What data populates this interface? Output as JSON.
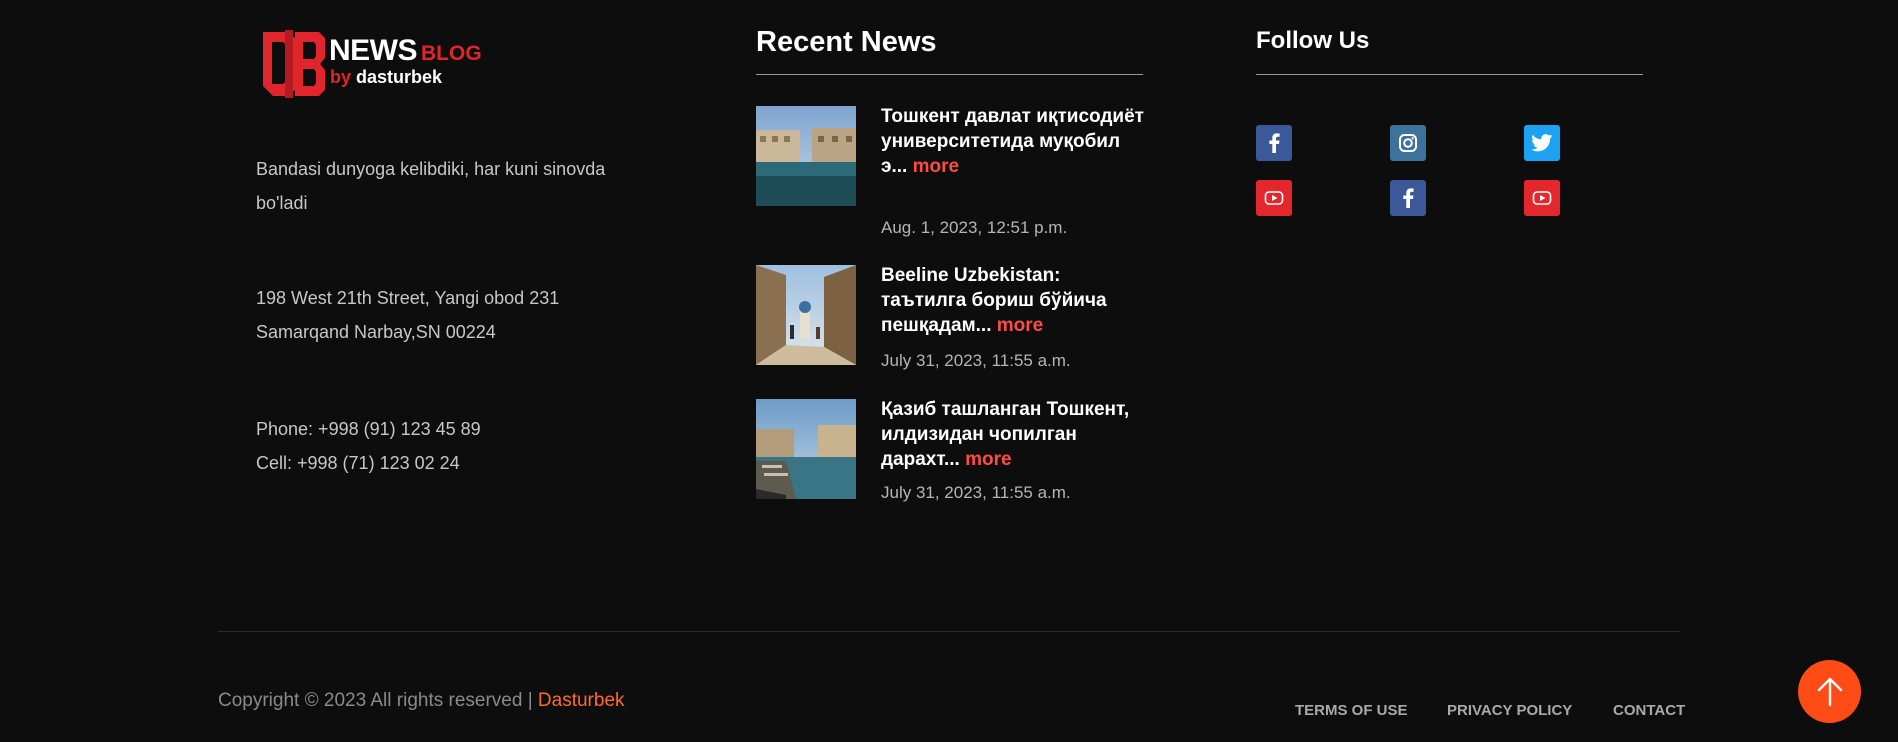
{
  "brand": {
    "news": "NEWS",
    "blog": "BLOG",
    "by": "by",
    "author": "dasturbek",
    "mark_color": "#e0252d"
  },
  "about": {
    "tagline": "Bandasi dunyoga kelibdiki, har kuni sinovda bo'ladi",
    "address_line1": "198 West 21th Street, Yangi obod 231",
    "address_line2": "Samarqand Narbay,SN 00224",
    "phone": "Phone: +998 (91) 123 45 89",
    "cell": "Cell: +998 (71) 123 02 24"
  },
  "recent_news": {
    "title": "Recent News",
    "more_label": "more",
    "items": [
      {
        "title": "Тошкент давлат иқтисодиёт университетида муқобил э...",
        "date": "Aug. 1, 2023, 12:51 p.m."
      },
      {
        "title": "Beeline Uzbekistan: таътилга бориш бўйича пешқадам...",
        "date": "July 31, 2023, 11:55 a.m."
      },
      {
        "title": "Қазиб ташланган Тошкент, илдизидан чопилган дарахт...",
        "date": "July 31, 2023, 11:55 a.m."
      }
    ]
  },
  "follow_us": {
    "title": "Follow Us",
    "icons": [
      "facebook-icon",
      "instagram-icon",
      "twitter-icon",
      "youtube-icon",
      "facebook-icon",
      "youtube-icon"
    ]
  },
  "footer": {
    "copyright": "Copyright © 2023 All rights reserved | ",
    "copyright_brand": "Dasturbek",
    "links": [
      "TERMS OF USE",
      "PRIVACY POLICY",
      "CONTACT"
    ]
  },
  "colors": {
    "background": "#0d0d0d",
    "accent": "#ff4b45",
    "brand_orange": "#ff6a2b",
    "to_top": "#ff4b16"
  }
}
